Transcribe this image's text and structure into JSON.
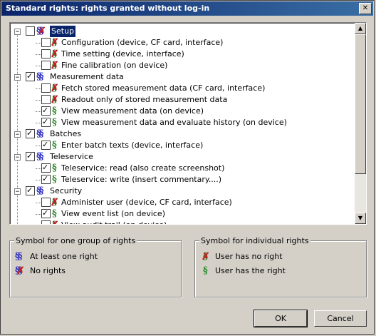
{
  "window": {
    "title": "Standard rights: rights granted without log-in",
    "close_glyph": "✕"
  },
  "tree": {
    "nodes": [
      {
        "level": 0,
        "expander": "−",
        "checked": false,
        "symbol": "none-group",
        "label": "Setup",
        "selected": true
      },
      {
        "level": 1,
        "checked": false,
        "symbol": "none",
        "label": "Configuration (device, CF card, interface)"
      },
      {
        "level": 1,
        "checked": false,
        "symbol": "none",
        "label": "Time setting (device, interface)"
      },
      {
        "level": 1,
        "checked": false,
        "symbol": "none",
        "label": "Fine calibration (on device)"
      },
      {
        "level": 0,
        "expander": "−",
        "checked": true,
        "symbol": "group",
        "label": "Measurement data"
      },
      {
        "level": 1,
        "checked": false,
        "symbol": "none",
        "label": "Fetch stored measurement data (CF card, interface)"
      },
      {
        "level": 1,
        "checked": false,
        "symbol": "none",
        "label": "Readout only of stored measurement data"
      },
      {
        "level": 1,
        "checked": true,
        "symbol": "right",
        "label": "View measurement data (on device)"
      },
      {
        "level": 1,
        "checked": true,
        "symbol": "right",
        "label": "View measurement data and evaluate history (on device)"
      },
      {
        "level": 0,
        "expander": "−",
        "checked": true,
        "symbol": "group",
        "label": "Batches"
      },
      {
        "level": 1,
        "checked": true,
        "symbol": "right",
        "label": "Enter batch texts (device, interface)"
      },
      {
        "level": 0,
        "expander": "−",
        "checked": true,
        "symbol": "group",
        "label": "Teleservice"
      },
      {
        "level": 1,
        "checked": true,
        "symbol": "right",
        "label": "Teleservice: read (also create screenshot)"
      },
      {
        "level": 1,
        "checked": true,
        "symbol": "right",
        "label": "Teleservice: write (insert commentary....)"
      },
      {
        "level": 0,
        "expander": "−",
        "checked": true,
        "symbol": "group",
        "label": "Security"
      },
      {
        "level": 1,
        "checked": false,
        "symbol": "none",
        "label": "Administer user (device, CF card, interface)"
      },
      {
        "level": 1,
        "checked": true,
        "symbol": "right",
        "label": "View event list (on device)"
      },
      {
        "level": 1,
        "checked": false,
        "symbol": "none",
        "label": "View audit trail (on device)"
      }
    ]
  },
  "symbols": {
    "paragraph": "§",
    "double": "§§",
    "cross": "✗"
  },
  "scrollbar": {
    "up": "▲",
    "down": "▼"
  },
  "legend_group": {
    "title": "Symbol for one group of rights",
    "items": [
      {
        "symbol": "group",
        "label": "At least one right"
      },
      {
        "symbol": "none-group",
        "label": "No rights"
      }
    ]
  },
  "legend_individual": {
    "title": "Symbol for individual rights",
    "items": [
      {
        "symbol": "none",
        "label": "User has no right"
      },
      {
        "symbol": "right",
        "label": "User has the right"
      }
    ]
  },
  "buttons": {
    "ok": "OK",
    "cancel": "Cancel"
  },
  "colors": {
    "group_symbol": "#3030c0",
    "right_symbol": "#2a8a2a",
    "cross": "#c02020",
    "selection": "#0a246a",
    "titlebar": "#0a246a"
  }
}
